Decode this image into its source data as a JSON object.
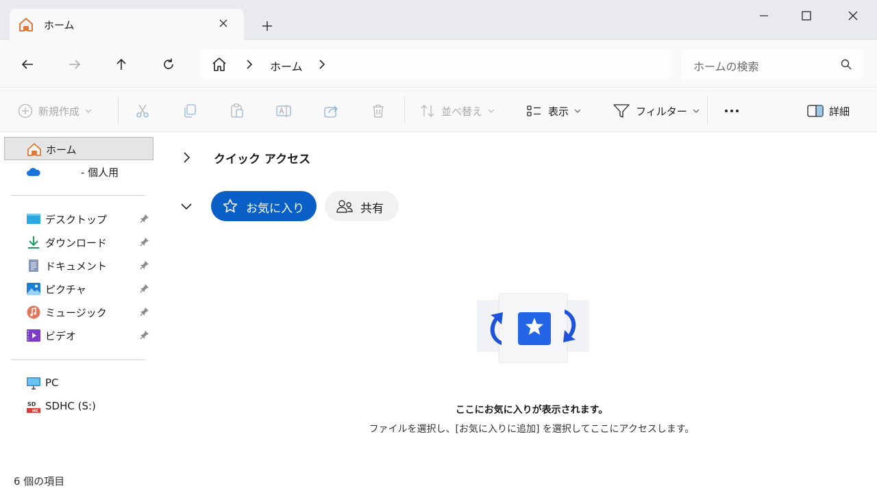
{
  "tab": {
    "title": "ホーム"
  },
  "address": {
    "crumb": "ホーム"
  },
  "search": {
    "placeholder": "ホームの検索"
  },
  "commands": {
    "new": "新規作成",
    "sort": "並べ替え",
    "view": "表示",
    "filter": "フィルター",
    "details": "詳細"
  },
  "sidebar": {
    "items": [
      {
        "label": "ホーム",
        "icon": "home-icon"
      },
      {
        "label": "- 個人用",
        "icon": "onedrive-icon"
      },
      {
        "label": "デスクトップ",
        "icon": "desktop-icon",
        "pinned": true
      },
      {
        "label": "ダウンロード",
        "icon": "download-icon",
        "pinned": true
      },
      {
        "label": "ドキュメント",
        "icon": "documents-icon",
        "pinned": true
      },
      {
        "label": "ピクチャ",
        "icon": "pictures-icon",
        "pinned": true
      },
      {
        "label": "ミュージック",
        "icon": "music-icon",
        "pinned": true
      },
      {
        "label": "ビデオ",
        "icon": "videos-icon",
        "pinned": true
      },
      {
        "label": "PC",
        "icon": "pc-icon"
      },
      {
        "label": "SDHC (S:)",
        "icon": "sd-card-icon"
      }
    ]
  },
  "main": {
    "quick_access": "クイック アクセス",
    "tabs": [
      {
        "label": "お気に入り"
      },
      {
        "label": "共有"
      }
    ],
    "empty_title": "ここにお気に入りが表示されます。",
    "empty_subtitle": "ファイルを選択し、[お気に入りに追加] を選択してここにアクセスします。"
  },
  "status": {
    "count": "6 個の項目"
  },
  "colors": {
    "accent": "#0a5fc7",
    "titlebar": "#e9eaee",
    "toolbar": "#f9f9f9"
  }
}
